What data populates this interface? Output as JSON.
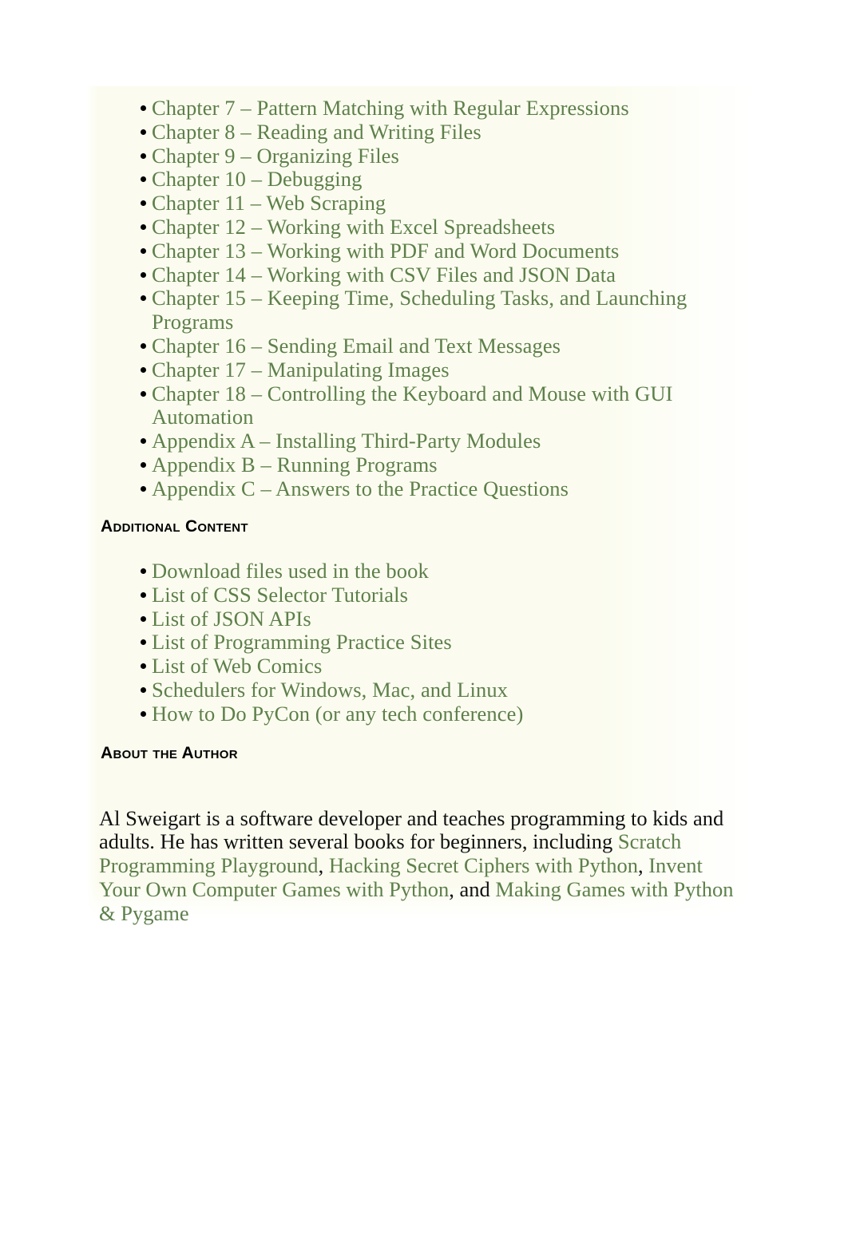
{
  "colors": {
    "link_green": "#5d7f4a",
    "body_text": "#111111",
    "slab_background": "#fbfcef",
    "page_background": "#ffffff",
    "bullet": "#000000"
  },
  "chapter_list": {
    "items": [
      "Chapter 7 – Pattern Matching with Regular Expressions",
      "Chapter 8 – Reading and Writing Files",
      "Chapter 9 – Organizing Files",
      "Chapter 10 – Debugging",
      "Chapter 11 – Web Scraping",
      "Chapter 12 – Working with Excel Spreadsheets",
      "Chapter 13 – Working with PDF and Word Documents",
      "Chapter 14 – Working with CSV Files and JSON Data",
      "Chapter 15 – Keeping Time, Scheduling Tasks, and Launching Programs",
      "Chapter 16 – Sending Email and Text Messages",
      "Chapter 17 – Manipulating Images",
      "Chapter 18 – Controlling the Keyboard and Mouse with GUI Automation",
      "Appendix A – Installing Third-Party Modules",
      "Appendix B – Running Programs",
      "Appendix C – Answers to the Practice Questions"
    ]
  },
  "additional_content": {
    "heading": "Additional Content",
    "items": [
      "Download files used in the book",
      "List of CSS Selector Tutorials",
      "List of JSON APIs",
      "List of Programming Practice Sites",
      "List of Web Comics",
      "Schedulers for Windows, Mac, and Linux",
      "How to Do PyCon (or any tech conference)"
    ]
  },
  "about_the_author": {
    "heading": "About the Author",
    "paragraph": {
      "part1": "Al Sweigart is a software developer and teaches programming to kids and adults. He has written several books for beginners, including ",
      "book1": "Scratch Programming Playground",
      "sep1": ", ",
      "book2": "Hacking Secret Ciphers with Python",
      "sep2": ", ",
      "book3": "Invent Your Own Computer Games with Python",
      "sep3": ", and ",
      "book4": "Making Games with Python & Pygame"
    }
  }
}
